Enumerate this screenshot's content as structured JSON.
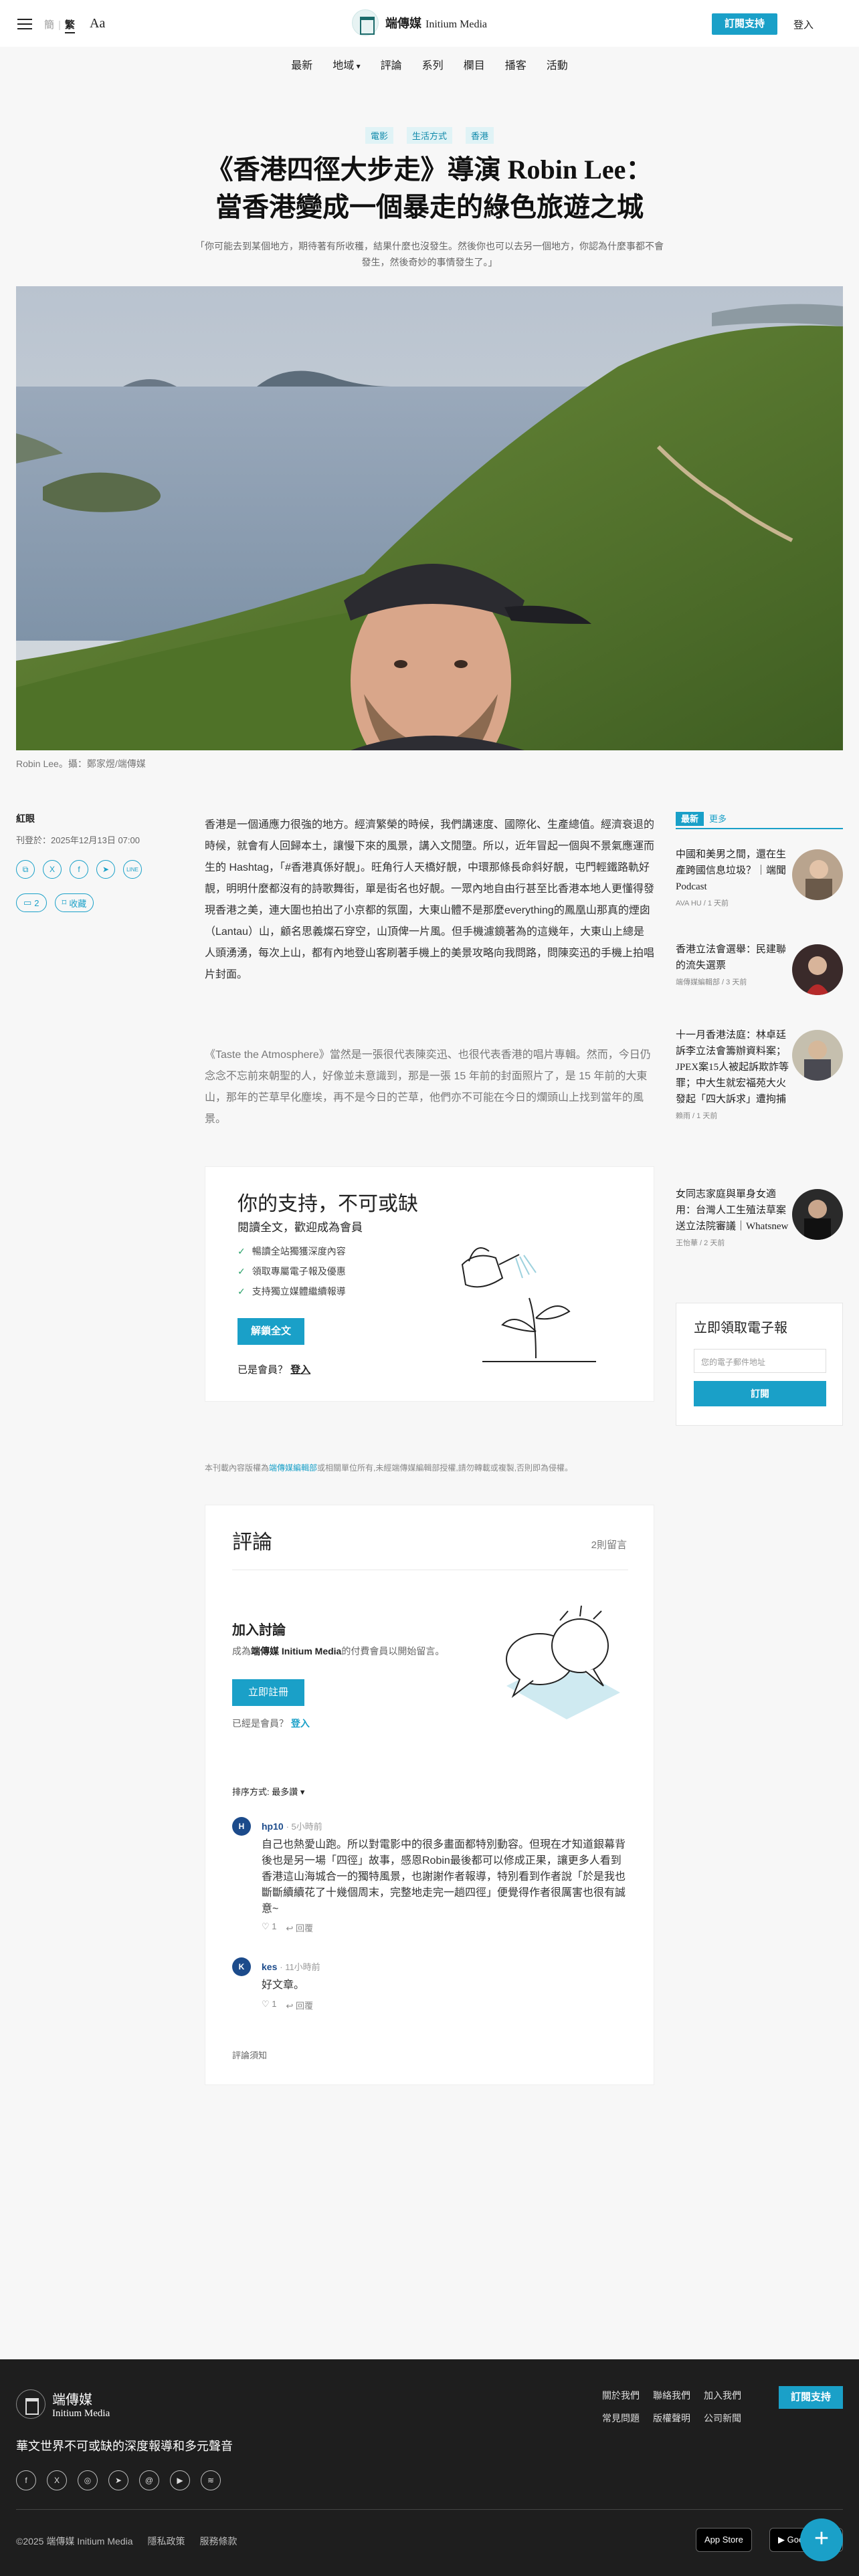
{
  "header": {
    "lang_trad": "繁",
    "lang_simp": "簡",
    "font_btn": "Aa",
    "logo_cn": "端傳媒",
    "logo_en": "Initium Media",
    "support": "訂閱支持",
    "login": "登入",
    "nav": [
      "最新",
      "地域",
      "評論",
      "系列",
      "欄目",
      "播客",
      "活動"
    ]
  },
  "article": {
    "tags": [
      "電影",
      "生活方式",
      "香港"
    ],
    "title_line1": "《香港四徑大步走》導演 Robin Lee：",
    "title_line2": "當香港變成一個暴走的綠色旅遊之城",
    "summary": "「你可能去到某個地方，期待著有所收穫，結果什麼也沒發生。然後你也可以去另一個地方，你認為什麼事都不會發生，然後奇妙的事情發生了。」",
    "caption": "Robin Lee。攝：鄭家煜/端傳媒",
    "author": "紅眼",
    "date": "刊登於：2025年12月13日 07:00",
    "comment_count": "2",
    "bookmark": "收藏",
    "share_icons": [
      "copy-icon",
      "x-icon",
      "facebook-icon",
      "telegram-icon",
      "line-icon"
    ],
    "para1": "香港是一個通應力很強的地方。經濟繁榮的時候，我們講速度、國際化、生產總值。經濟衰退的時候，就會有人回歸本土，讓慢下來的風景，講入文閒墮。所以，近年冒起一個與不景氣應運而生的 Hashtag，「#香港真係好靚」。旺角行人天橋好靚，中環那條長命斜好靚，屯門輕鐵路軌好靚，明明什麼都沒有的詩歌舞街，單是街名也好靚。一眾內地自由行甚至比香港本地人更懂得發現香港之美，連大圍也拍出了小京都的氛圍，大東山體不是那麼everything的鳳凰山那真的煙囱（Lantau）山，顧名思義燦石穿空，山頂俾一片風。但手機濾鏡著為的這幾年，大東山上總是人頭湧湧，每次上山，都有內地登山客刷著手機上的美景攻略向我問路，問陳奕迅的手機上拍唱片封面。",
    "para2": "《Taste the Atmosphere》當然是一張很代表陳奕迅、也很代表香港的唱片專輯。然而，今日仍念念不忘前來朝聖的人，好像並未意識到，那是一張 15 年前的封面照片了，是 15 年前的大東山，那年的芒草早化塵埃，再不是今日的芒草，他們亦不可能在今日的爛頭山上找到當年的風景。"
  },
  "paywall": {
    "title": "你的支持，不可或缺",
    "subtitle": "閱讀全文，歡迎成為會員",
    "benefits": [
      "暢讀全站獨獲深度內容",
      "領取專屬電子報及優惠",
      "支持獨立媒體繼續報導"
    ],
    "cta": "解鎖全文",
    "member_q": "已是會員？",
    "member_login": "登入"
  },
  "copyright": {
    "prefix": "本刊載內容版權為",
    "owner": "端傳媒編輯部",
    "suffix": "或相關單位所有,未經端傳媒編輯部授權,請勿轉載或複製,否則即為侵權。"
  },
  "comments": {
    "title": "評論",
    "count": "2則留言",
    "join_title": "加入討論",
    "join_sub_prefix": "成為",
    "join_sub_brand": "端傳媒 Initium Media",
    "join_sub_suffix": "的付費會員以開始留言。",
    "register": "立即註冊",
    "already_q": "已經是會員？",
    "already_login": "登入",
    "sort": "排序方式: 最多讚",
    "items": [
      {
        "avatar": "H",
        "user": "hp10",
        "time": "· 5小時前",
        "text": "自己也熱愛山跑。所以對電影中的很多畫面都特別動容。但現在才知道銀幕背後也是另一場「四徑」故事，感恩Robin最後都可以修成正果，讓更多人看到香港這山海城合一的獨特風景，也謝謝作者報導，特別看到作者說「於是我也斷斷續續花了十幾個周末，完整地走完一趟四徑」便覺得作者很厲害也很有誠意~",
        "likes": "1",
        "reply": "回覆"
      },
      {
        "avatar": "K",
        "user": "kes",
        "time": "· 11小時前",
        "text": "好文章。",
        "likes": "1",
        "reply": "回覆"
      }
    ],
    "notice": "評論須知"
  },
  "sidebar": {
    "tab_latest": "最新",
    "tab_more": "更多",
    "items": [
      {
        "title": "中國和美男之間，還在生產跨國信息垃圾？｜端聞 Podcast",
        "meta": "AVA HU / 1 天前"
      },
      {
        "title": "香港立法會選舉：民建聯的流失選票",
        "meta": "端傳媒編輯部 / 3 天前"
      },
      {
        "title": "十一月香港法庭：林卓廷訴李立法會籌辦資料案；JPEX案15人被起訴欺詐等罪；中大生就宏福苑大火發起「四大訴求」遭拘捕",
        "meta": "賴雨 / 1 天前"
      },
      {
        "title": "女同志家庭與單身女適用：台灣人工生殖法草案送立法院審議｜Whatsnew",
        "meta": "王怡華 / 2 天前"
      }
    ],
    "newsletter_title": "立即領取電子報",
    "newsletter_placeholder": "您的電子郵件地址",
    "newsletter_btn": "訂閱"
  },
  "footer": {
    "brand_cn": "端傳媒",
    "brand_en": "Initium Media",
    "tagline": "華文世界不可或缺的深度報導和多元聲音",
    "links": [
      "關於我們",
      "聯絡我們",
      "加入我們",
      "常見問題",
      "版權聲明",
      "公司新聞"
    ],
    "support": "訂閱支持",
    "copyright": "©2025 端傳媒 Initium Media",
    "privacy": "隱私政策",
    "terms": "服務條款",
    "app_store": "App Store",
    "google_play": "Google Play",
    "social": [
      "facebook-icon",
      "x-icon",
      "instagram-icon",
      "telegram-icon",
      "threads-icon",
      "youtube-icon",
      "rss-icon"
    ]
  },
  "colors": {
    "accent": "#1aa0c8",
    "footer_bg": "#1e1e1e"
  }
}
